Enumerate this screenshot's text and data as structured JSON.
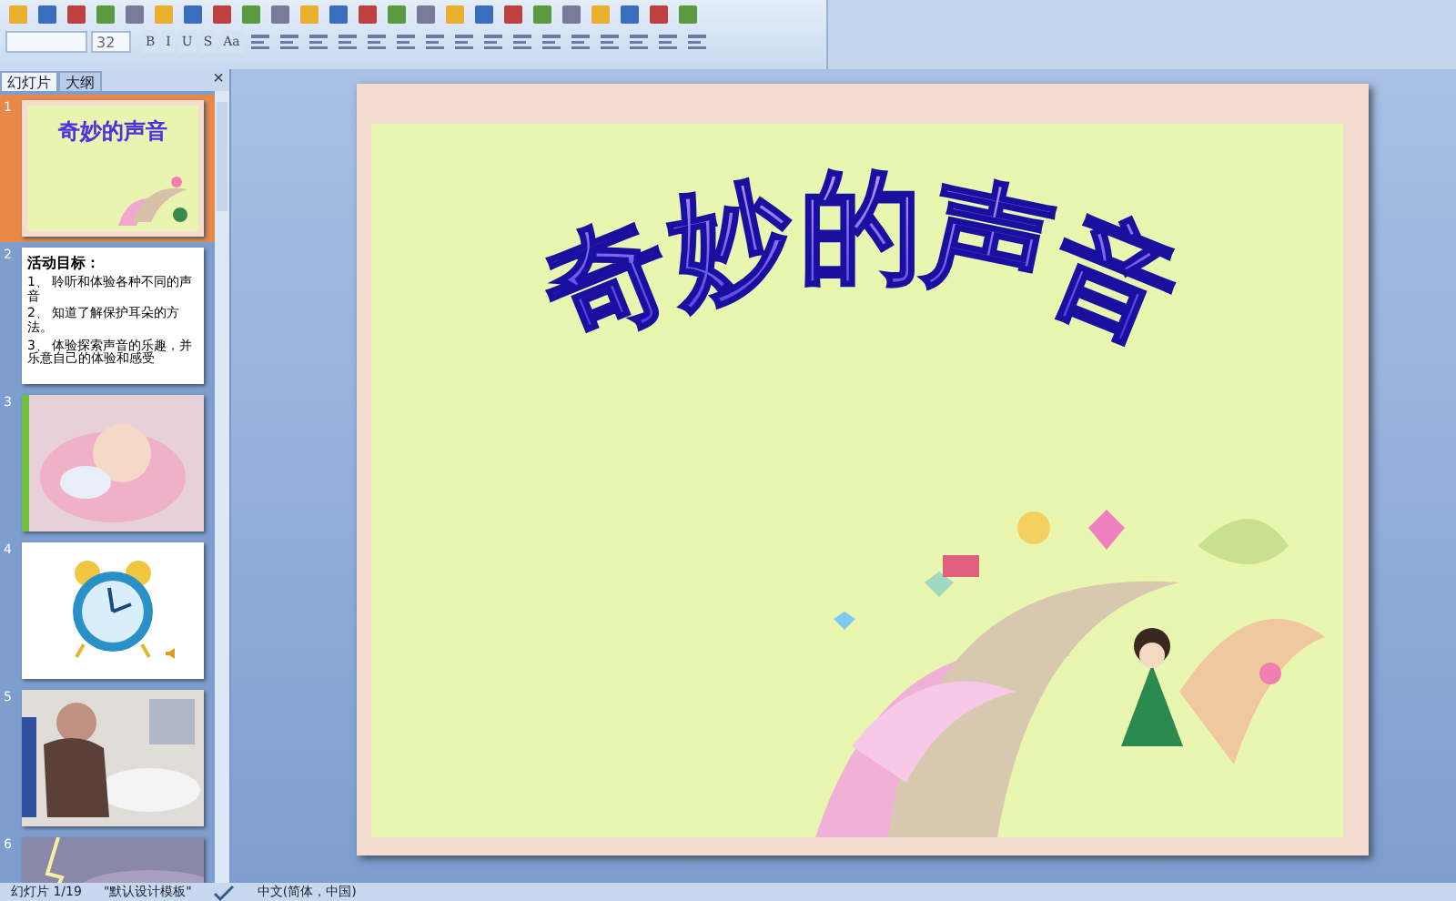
{
  "toolbar": {
    "font_size": "32",
    "format_buttons": [
      "B",
      "I",
      "U",
      "S",
      "Aa"
    ]
  },
  "pane_tabs": [
    {
      "label": "幻灯片",
      "selected": true
    },
    {
      "label": "大纲",
      "selected": false
    }
  ],
  "pane_close": "×",
  "thumbnails": [
    {
      "number": "1",
      "kind": "title",
      "selected": true,
      "title": "奇妙的声音"
    },
    {
      "number": "2",
      "kind": "text",
      "selected": false,
      "heading": "活动目标：",
      "lines": [
        "1、 聆听和体验各种不同的声音",
        "2、 知道了解保护耳朵的方法。",
        "3、 体验探索声音的乐趣，并乐意自己的体验和感受"
      ]
    },
    {
      "number": "3",
      "selected": false
    },
    {
      "number": "4",
      "kind": "clock",
      "selected": false
    },
    {
      "number": "5",
      "selected": false
    },
    {
      "number": "6",
      "selected": false
    }
  ],
  "slide": {
    "title": "奇妙的声音"
  },
  "status_bar": {
    "slide_info": "幻灯片 1/19",
    "theme": "\"默认设计模板\"",
    "language": "中文(简体，中国)"
  }
}
